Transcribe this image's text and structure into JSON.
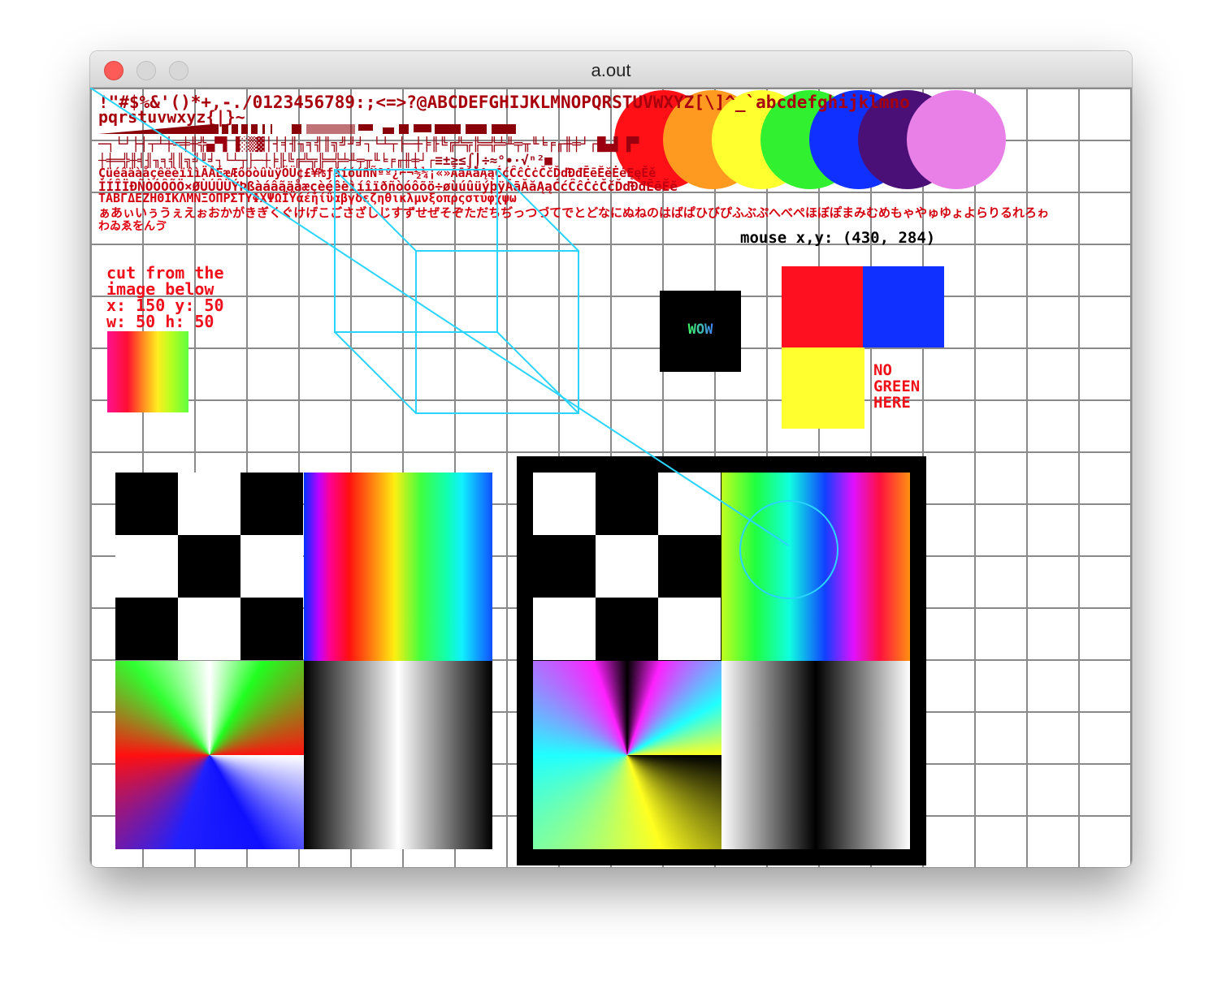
{
  "window": {
    "title": "a.out"
  },
  "text_rows": {
    "ascii_line1": "!\"#$%&'()*+,-./0123456789:;<=>?@ABCDEFGHIJKLMNOPQRSTUVWXYZ[\\]^_`abcdefghijklmno",
    "ascii_line2": "pqrstuvwxyz{|}~",
    "box_drawing_line1": "─┐└┘├┤┬┴┼═╪╫╬▄▀▌▐░▒▓│┤╡╢╖╕╣║╗╝╜╛┐└┴┬├─┼╞╟╚╔╩╦╠═╬╧╨╤╥╙╘╒╓╫╪┘┌█▄▌▐▀",
    "box_drawing_line2": "┼╪═╬╫╡╢╖╕╣║╗╝╜╛┐└┴┬├─┼╞╟╚╔╩╦╠═╬╧╨╤╥╙╘╒╓╫╪┘┌≡±≥≤⌠⌡÷≈°∙·√ⁿ²■",
    "latin1_line1": "ÇüéâäàåçêëèïîìÄÅÉæÆôöòûùÿÖÜ¢£¥₧ƒáíóúñÑªº¿⌐¬½¼¡«»ĀāĂăĄąĆćĈĉĊċČčĎďĐđĒēĔĕĖėĘęĚě",
    "latin1_line2": "ÌÍÎÏÐÑÒÓÔÕÖ×ØÙÚÛÜÝÞßàáâãäåæçèéêëìíîïðñòóôõö÷øùúûüýþÿĀāĂăĄąĆćĈĉĊċČčĎďĐđĒēĔĕ",
    "greek_line": "ΤΑΒΓΔΕΖΗΘΙΚΛΜΝΞΟΠΡΣΤΥΦΧΨΩΪΫάέήίΰαβγδεζηθικλμνξοπρςστυφχψω",
    "hiragana_line1": "ぁあぃいぅうぇえぉおかがきぎくぐけげこごさざしじすずせぜそぞただちぢっつづてでとどなにぬねのはばぱひびぴふぶぷへべぺほぼぽまみむめもゃやゅゆょよらりるれろゎ",
    "hiragana_line2": "わゐゑをんゔ"
  },
  "mouse_readout": "mouse x,y: (430, 284)",
  "cut_label": {
    "line1": "cut from the",
    "line2": "image below",
    "line3": "x: 150 y: 50",
    "line4": "w: 50 h: 50"
  },
  "wow_label": "WOW",
  "no_green_label": {
    "line1": "NO",
    "line2": "GREEN",
    "line3": "HERE"
  },
  "colors": {
    "circle_red": "#ff1016",
    "circle_orange": "#ff9a20",
    "circle_yellow": "#ffff30",
    "circle_green": "#30f030",
    "circle_blue": "#1030ff",
    "circle_purple": "#4a1078",
    "circle_violet": "#e880e8",
    "swatch_red": "#ff1020",
    "swatch_blue": "#1030ff",
    "swatch_yellow": "#ffff30",
    "wireframe": "#2ad4ff",
    "grid": "#8a8a8a",
    "text_red": "#a8000c"
  }
}
